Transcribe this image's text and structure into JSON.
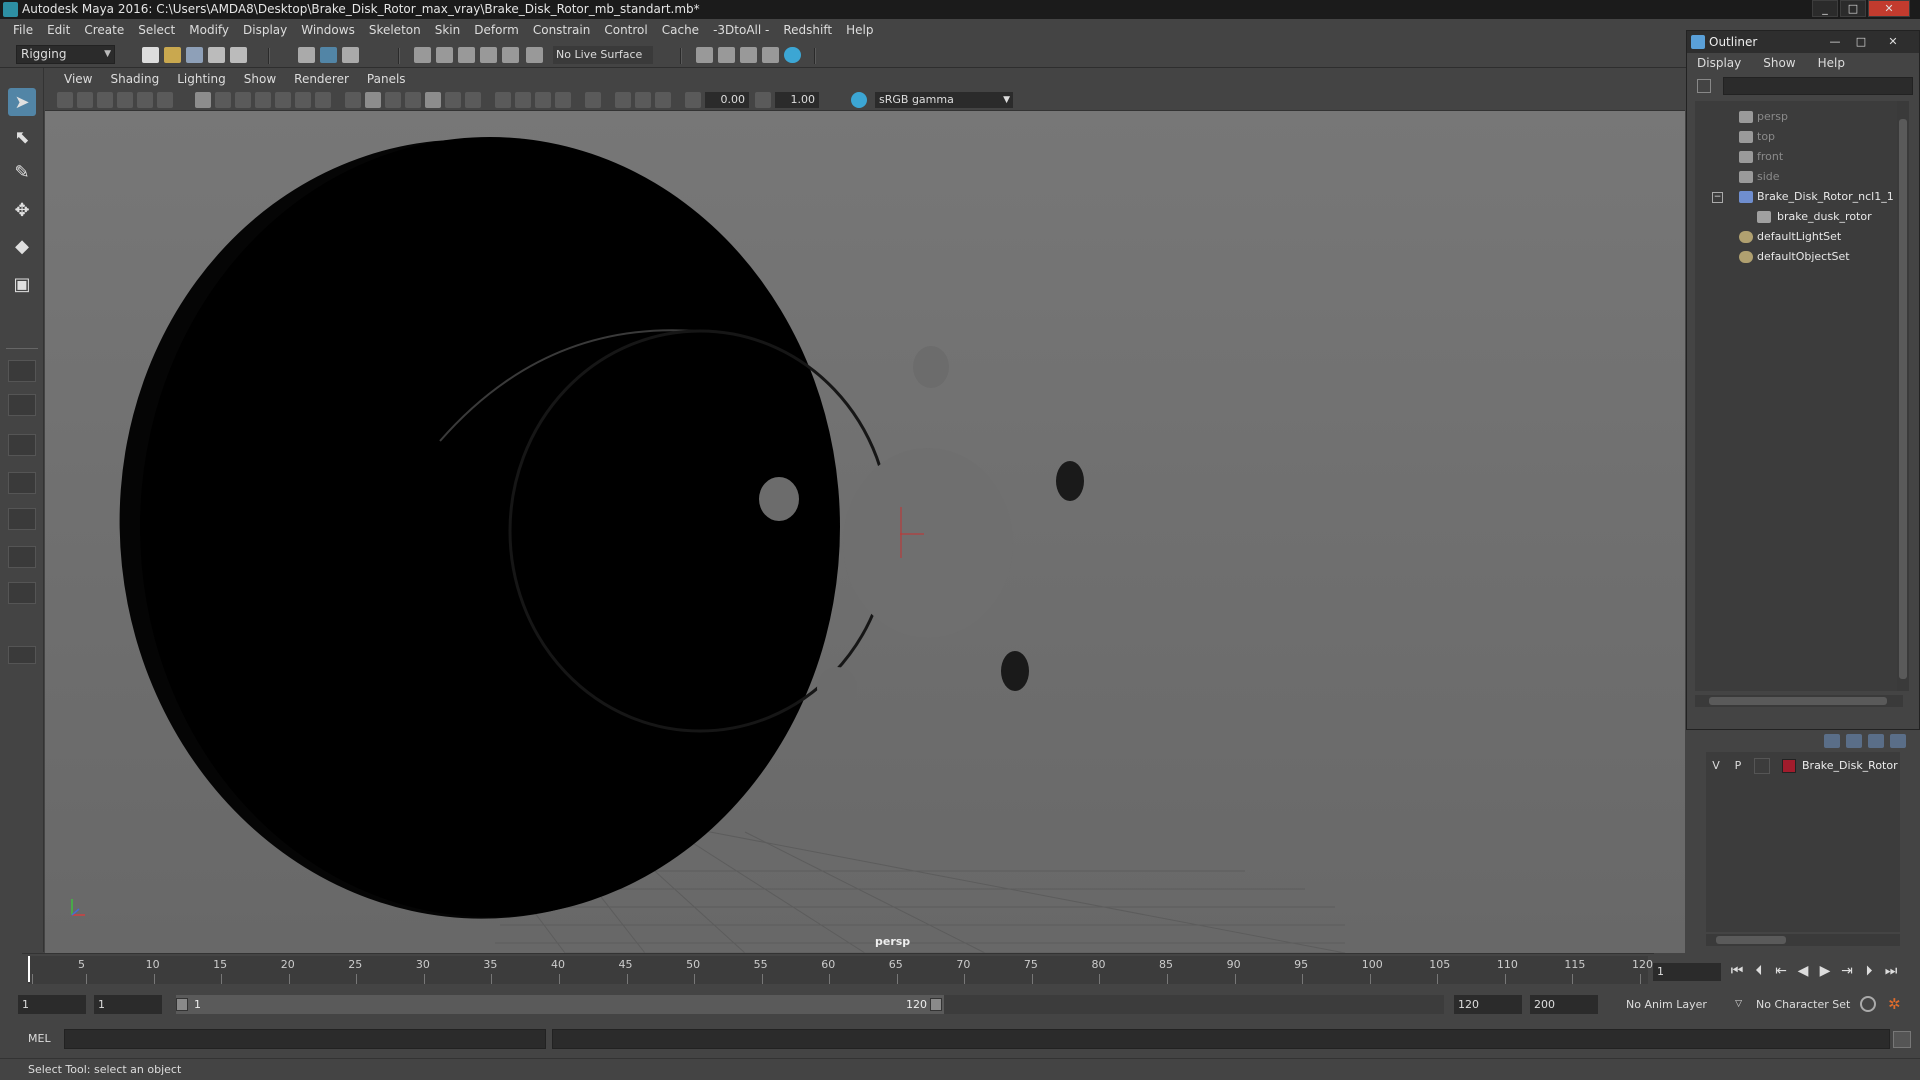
{
  "window": {
    "title": "Autodesk Maya 2016: C:\\Users\\AMDA8\\Desktop\\Brake_Disk_Rotor_max_vray\\Brake_Disk_Rotor_mb_standart.mb*"
  },
  "menubar": {
    "items": [
      "File",
      "Edit",
      "Create",
      "Select",
      "Modify",
      "Display",
      "Windows",
      "Skeleton",
      "Skin",
      "Deform",
      "Constrain",
      "Control",
      "Cache",
      "-3DtoAll -",
      "Redshift",
      "Help"
    ]
  },
  "toolbar": {
    "mode": "Rigging",
    "live_surface": "No Live Surface"
  },
  "panel": {
    "menu": [
      "View",
      "Shading",
      "Lighting",
      "Show",
      "Renderer",
      "Panels"
    ],
    "exposure": "0.00",
    "gamma": "1.00",
    "color_space": "sRGB gamma",
    "camera_label": "persp"
  },
  "outliner": {
    "title": "Outliner",
    "menu": [
      "Display",
      "Show",
      "Help"
    ],
    "items": [
      {
        "label": "persp",
        "icon": "camera-icon"
      },
      {
        "label": "top",
        "icon": "camera-icon"
      },
      {
        "label": "front",
        "icon": "camera-icon"
      },
      {
        "label": "side",
        "icon": "camera-icon"
      },
      {
        "label": "Brake_Disk_Rotor_ncl1_1",
        "icon": "group-icon"
      },
      {
        "label": "brake_dusk_rotor",
        "icon": "mesh-icon"
      },
      {
        "label": "defaultLightSet",
        "icon": "set-icon"
      },
      {
        "label": "defaultObjectSet",
        "icon": "set-icon"
      }
    ]
  },
  "layers": {
    "visibility": "V",
    "playback": "P",
    "name": "Brake_Disk_Rotor",
    "color": "#a11c2c"
  },
  "timeline": {
    "ticks": [
      "1",
      "5",
      "10",
      "15",
      "20",
      "25",
      "30",
      "35",
      "40",
      "45",
      "50",
      "55",
      "60",
      "65",
      "70",
      "75",
      "80",
      "85",
      "90",
      "95",
      "100",
      "105",
      "110",
      "115",
      "120"
    ],
    "current_frame": "1"
  },
  "range": {
    "start_field": "1",
    "playback_start": "1",
    "slider_start": "1",
    "slider_end": "120",
    "playback_end": "120",
    "end_field": "200",
    "anim_layer": "No Anim Layer",
    "character_set": "No Character Set"
  },
  "command_line": {
    "label": "MEL"
  },
  "helpline": {
    "text": "Select Tool: select an object"
  },
  "colors": {
    "accent": "#5285a6",
    "maya_teal": "#29a8c9",
    "layer_red": "#a11c2c"
  }
}
